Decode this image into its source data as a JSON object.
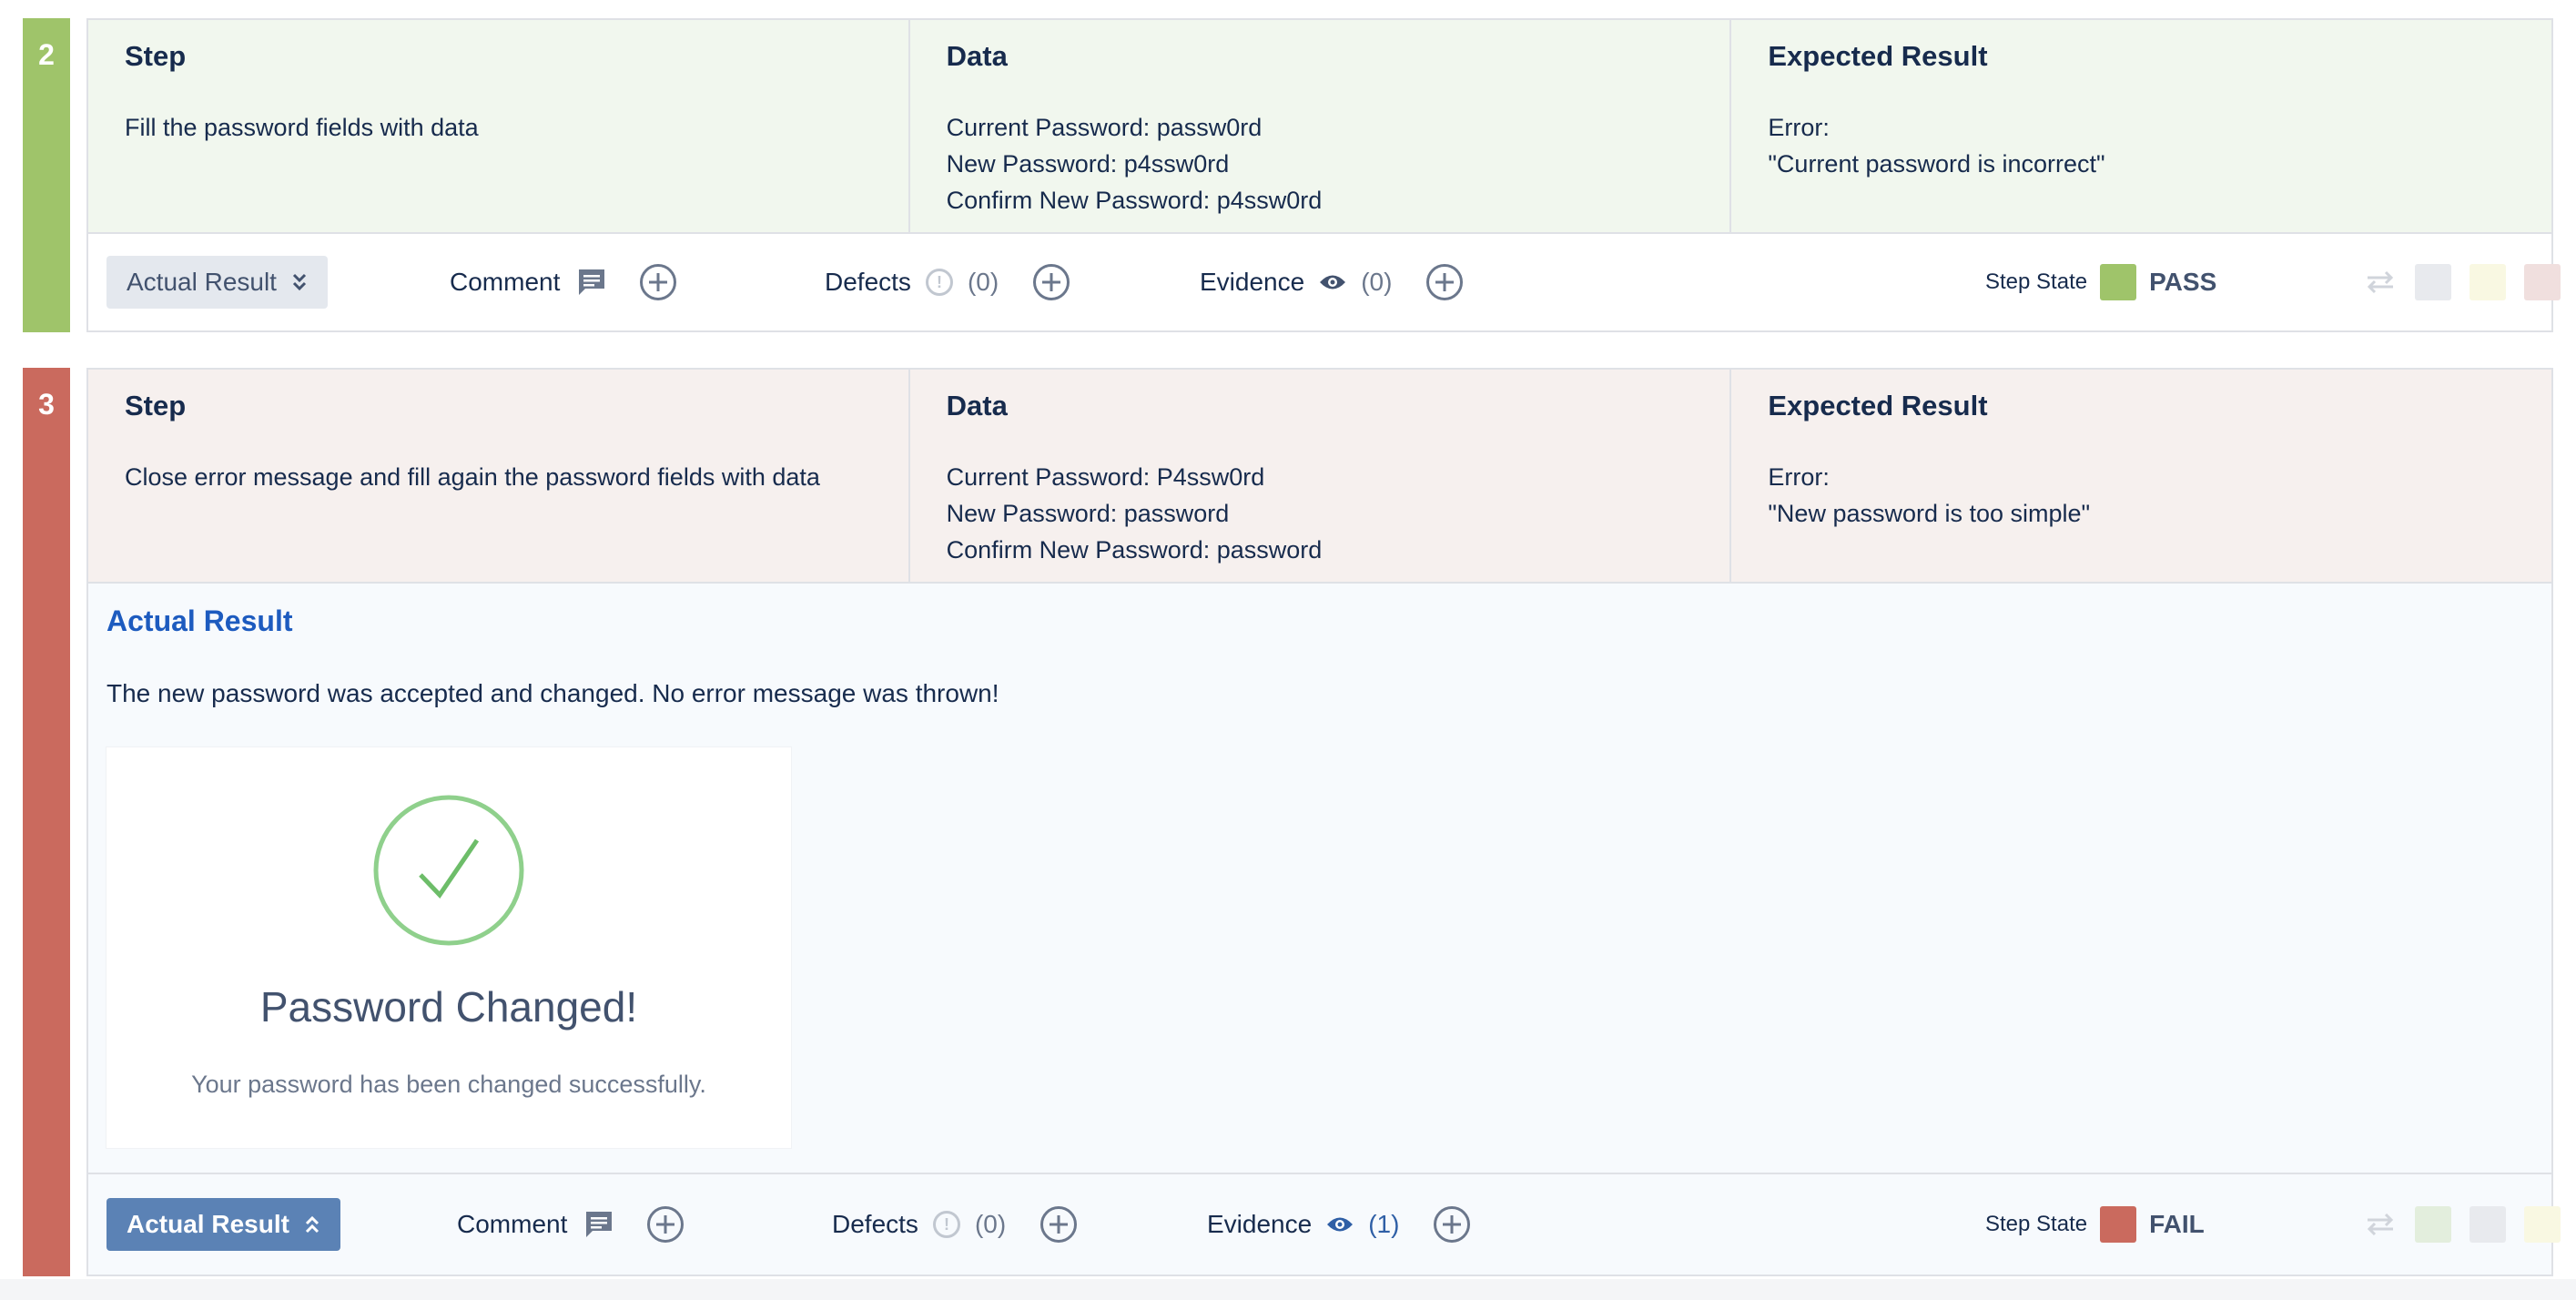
{
  "colors": {
    "pass": "#9fc46a",
    "fail": "#ca6a5e",
    "pass_bg": "#f1f7ee",
    "fail_bg": "#f6f0ee",
    "expanded_bg": "#f7fafd",
    "link_blue": "#1d5bbf"
  },
  "step2": {
    "number": "2",
    "step_header": "Step",
    "step_text": "Fill the password fields with data",
    "data_header": "Data",
    "data_lines": [
      "Current Password: passw0rd",
      "New Password: p4ssw0rd",
      "Confirm New Password: p4ssw0rd"
    ],
    "expected_header": "Expected Result",
    "expected_lines": [
      "Error:",
      "\"Current password is incorrect\""
    ],
    "toolbar": {
      "actual_result_btn": "Actual Result",
      "comment": "Comment",
      "defects": "Defects",
      "defects_count": "(0)",
      "evidence": "Evidence",
      "evidence_count": "(0)",
      "step_state_label": "Step State",
      "step_state": "PASS"
    }
  },
  "step3": {
    "number": "3",
    "step_header": "Step",
    "step_text": "Close error message and fill again the password fields with data",
    "data_header": "Data",
    "data_lines": [
      "Current Password: P4ssw0rd",
      "New Password: password",
      "Confirm New Password: password"
    ],
    "expected_header": "Expected Result",
    "expected_lines": [
      "Error:",
      "\"New password is too simple\""
    ],
    "actual_result_title": "Actual Result",
    "actual_result_text": "The new password was accepted and changed. No error message was thrown!",
    "evidence_image": {
      "title": "Password Changed!",
      "subtitle": "Your password has been changed successfully."
    },
    "toolbar": {
      "actual_result_btn": "Actual Result",
      "comment": "Comment",
      "defects": "Defects",
      "defects_count": "(0)",
      "evidence": "Evidence",
      "evidence_count": "(1)",
      "step_state_label": "Step State",
      "step_state": "FAIL"
    }
  }
}
